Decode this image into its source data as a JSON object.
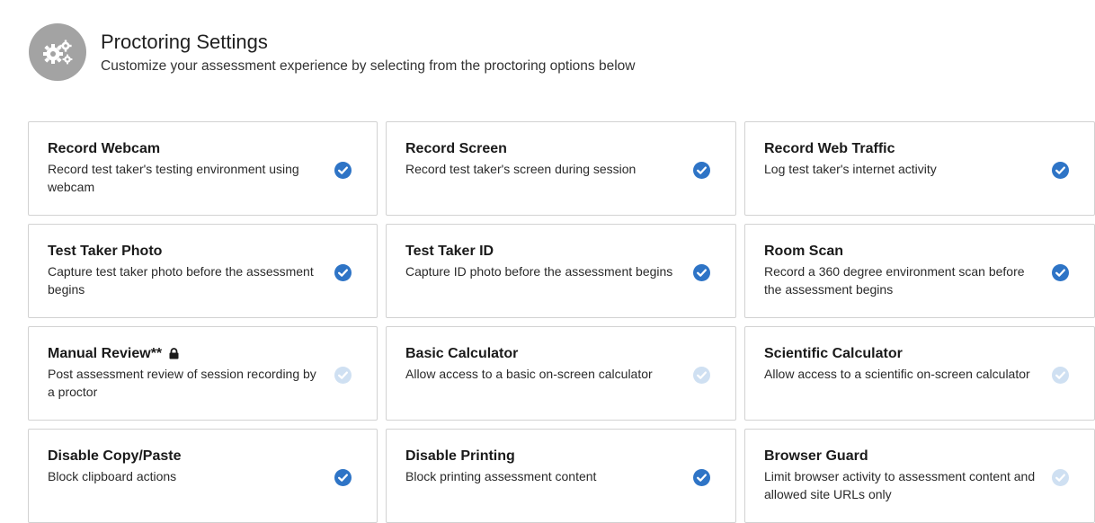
{
  "header": {
    "title": "Proctoring Settings",
    "subtitle": "Customize your assessment experience by selecting from the proctoring options below",
    "icon": "gears-icon"
  },
  "colors": {
    "checked": "#2e74c6",
    "unchecked": "#cfe0f2",
    "badge": "#a3a3a3"
  },
  "options": [
    {
      "key": "record-webcam",
      "title": "Record Webcam",
      "desc": "Record test taker's testing environment using webcam",
      "checked": true
    },
    {
      "key": "record-screen",
      "title": "Record Screen",
      "desc": "Record test taker's screen during session",
      "checked": true
    },
    {
      "key": "record-web-traffic",
      "title": "Record Web Traffic",
      "desc": "Log test taker's internet activity",
      "checked": true
    },
    {
      "key": "test-taker-photo",
      "title": "Test Taker Photo",
      "desc": "Capture test taker photo before the assessment begins",
      "checked": true
    },
    {
      "key": "test-taker-id",
      "title": "Test Taker ID",
      "desc": "Capture ID photo before the assessment begins",
      "checked": true
    },
    {
      "key": "room-scan",
      "title": "Room Scan",
      "desc": "Record a 360 degree environment scan before the assessment begins",
      "checked": true
    },
    {
      "key": "manual-review",
      "title": "Manual Review**",
      "desc": "Post assessment review of session recording by a proctor",
      "checked": false,
      "locked": true
    },
    {
      "key": "basic-calculator",
      "title": "Basic Calculator",
      "desc": "Allow access to a basic on-screen calculator",
      "checked": false
    },
    {
      "key": "scientific-calculator",
      "title": "Scientific Calculator",
      "desc": "Allow access to a scientific on-screen calculator",
      "checked": false
    },
    {
      "key": "disable-copy-paste",
      "title": "Disable Copy/Paste",
      "desc": "Block clipboard actions",
      "checked": true
    },
    {
      "key": "disable-printing",
      "title": "Disable Printing",
      "desc": "Block printing assessment content",
      "checked": true
    },
    {
      "key": "browser-guard",
      "title": "Browser Guard",
      "desc": "Limit browser activity to assessment content and allowed site URLs only",
      "checked": false
    }
  ]
}
